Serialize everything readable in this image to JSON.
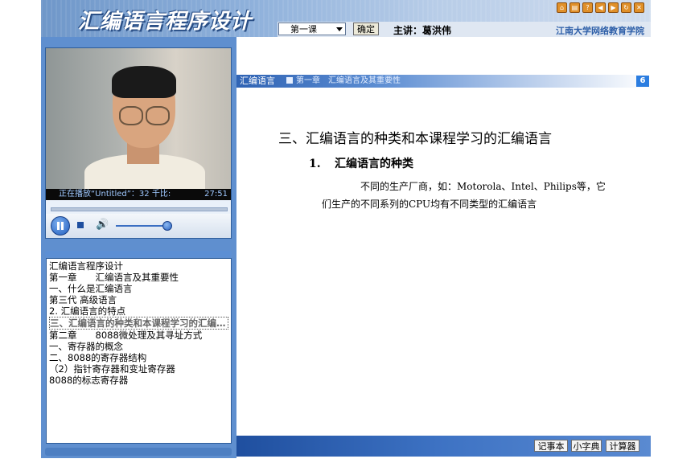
{
  "header": {
    "app_title": "汇编语言程序设计",
    "lesson_select_value": "第一课",
    "confirm_label": "确定",
    "lecturer": "主讲：葛洪伟",
    "school": "江南大学网络教育学院",
    "icons": [
      "home-icon",
      "print-icon",
      "help-icon",
      "prev-icon",
      "next-icon",
      "refresh-icon",
      "close-icon"
    ]
  },
  "player": {
    "status_text": "正在播放“Untitled”：32 千比:",
    "time": "27:51"
  },
  "toc": {
    "items": [
      "汇编语言程序设计",
      "第一章　　汇编语言及其重要性",
      "一、什么是汇编语言",
      "第三代 高级语言",
      "2. 汇编语言的特点",
      "三、汇编语言的种类和本课程学习的汇编语言",
      "第二章　　8088微处理及其寻址方式",
      "一、寄存器的概念",
      "二、8088的寄存器结构",
      "（2）指针寄存器和变址寄存器",
      "8088的标志寄存器"
    ],
    "active_index": 5
  },
  "content": {
    "breadcrumb_course": "汇编语言",
    "breadcrumb_chapter": "第一章",
    "breadcrumb_section": "汇编语言及其重要性",
    "page_number": "6",
    "heading": "三、汇编语言的种类和本课程学习的汇编语言",
    "subheading_number": "1.",
    "subheading": "汇编语言的种类",
    "paragraph_line1": "不同的生产厂商，如：Motorola、Intel、Philips等，它",
    "paragraph_line2": "们生产的不同系列的CPU均有不同类型的汇编语言"
  },
  "tools": {
    "notepad": "记事本",
    "dictionary": "小字典",
    "calculator": "计算器"
  }
}
